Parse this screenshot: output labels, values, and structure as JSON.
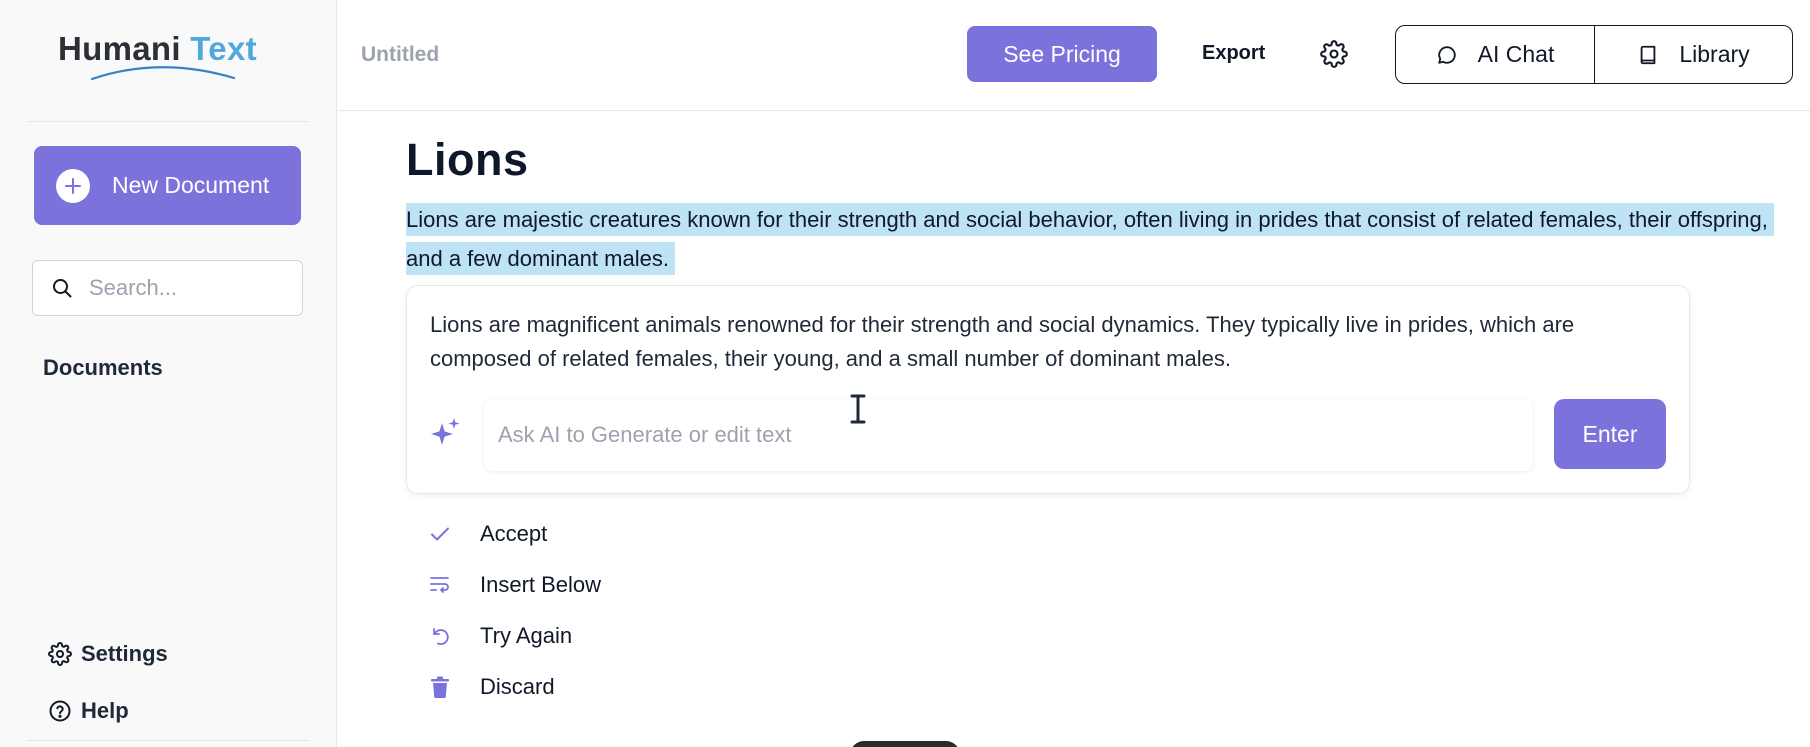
{
  "brand": {
    "name_part1": "Humani",
    "name_part2": "Text",
    "color_primary": "#7b72dc",
    "color_logo_accent": "#52a8dc",
    "color_selection": "#bde3f5"
  },
  "sidebar": {
    "new_document_label": "New Document",
    "search_placeholder": "Search...",
    "documents_heading": "Documents",
    "settings_label": "Settings",
    "help_label": "Help"
  },
  "header": {
    "doc_title": "Untitled",
    "pricing_label": "See Pricing",
    "export_label": "Export",
    "ai_chat_label": "AI Chat",
    "library_label": "Library"
  },
  "editor": {
    "heading": "Lions",
    "selected_paragraph": "Lions are majestic creatures known for their strength and social behavior, often living in prides that consist of related females, their offspring, and a few dominant males.",
    "suggestion": "Lions are magnificent animals renowned for their strength and social dynamics. They typically live in prides, which are composed of related females, their young, and a small number of dominant males.",
    "ai_input_placeholder": "Ask AI to Generate or edit text",
    "enter_label": "Enter",
    "actions": {
      "accept": "Accept",
      "insert_below": "Insert Below",
      "try_again": "Try Again",
      "discard": "Discard"
    }
  },
  "icons": [
    "plus-icon",
    "search-icon",
    "gear-icon",
    "help-icon",
    "chat-bubble-icon",
    "book-icon",
    "sparkle-icon",
    "check-icon",
    "insert-below-icon",
    "undo-icon",
    "trash-icon",
    "text-cursor-icon"
  ]
}
